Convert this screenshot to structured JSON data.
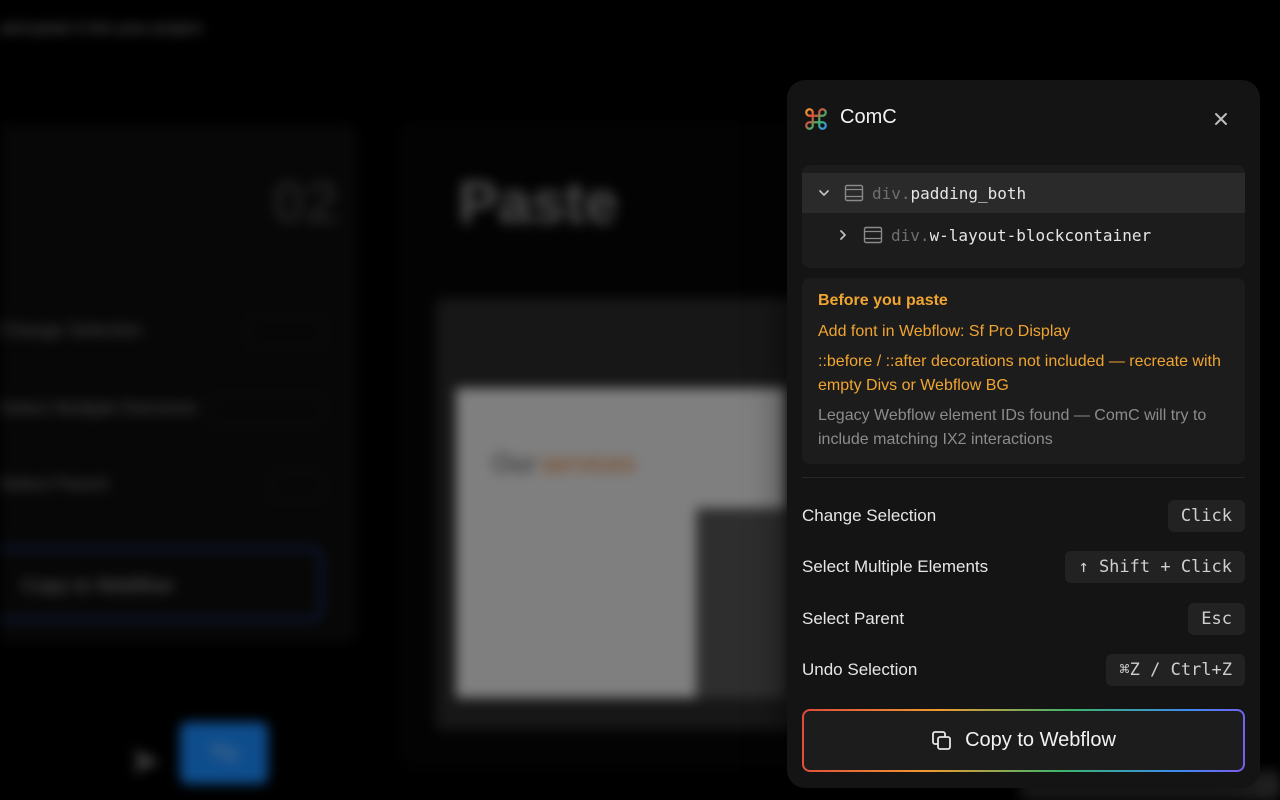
{
  "background": {
    "subtitle": "and paste it into your project.",
    "step_number": "02",
    "step_title": "Paste",
    "rows": [
      "Change Selection",
      "Select Multiple Elements",
      "Select Parent"
    ],
    "pills": [
      "Click",
      "Shift + Click",
      "Esc"
    ],
    "copy_label": "Copy to Webflow",
    "screenshot_heading_1": "Our",
    "screenshot_heading_2": "services",
    "try_label": "Try"
  },
  "panel": {
    "title": "ComC",
    "tree": [
      {
        "tag": "div.",
        "class": "padding_both",
        "expanded": true,
        "selected": true
      },
      {
        "tag": "div.",
        "class": "w-layout-blockcontainer",
        "expanded": false,
        "selected": false
      }
    ],
    "notice": {
      "title": "Before you paste",
      "items": [
        {
          "text": "Add font in Webflow: Sf Pro Display",
          "tone": "warning"
        },
        {
          "text": "::before / ::after decorations not included — recreate with empty Divs or Webflow BG",
          "tone": "warning"
        },
        {
          "text": "Legacy Webflow element IDs found — ComC will try to include matching IX2 interactions",
          "tone": "muted"
        }
      ]
    },
    "shortcuts": [
      {
        "label": "Change Selection",
        "key": "Click"
      },
      {
        "label": "Select Multiple Elements",
        "key": "↑ Shift + Click"
      },
      {
        "label": "Select Parent",
        "key": "Esc"
      },
      {
        "label": "Undo Selection",
        "key": "⌘Z / Ctrl+Z"
      }
    ],
    "copy_button": "Copy to Webflow"
  },
  "colors": {
    "warning": "#f0a530",
    "muted": "#8c8c8c",
    "panel_bg": "#141414",
    "accent_blue": "#1a8cff"
  },
  "icons": {
    "logo": "command-key-icon",
    "close": "close-icon",
    "tree_expanded": "chevron-down-icon",
    "tree_collapsed": "chevron-right-icon",
    "element": "element-box-icon",
    "copy": "copy-icon"
  }
}
